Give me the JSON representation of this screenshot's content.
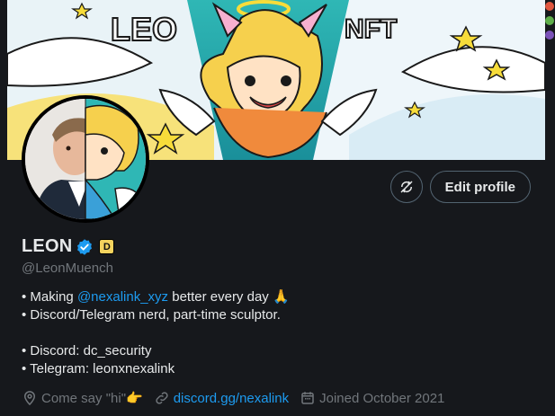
{
  "banner": {
    "title_left": "LEO",
    "title_right": "NFT"
  },
  "actions": {
    "edit_label": "Edit profile",
    "icon": "sync-off-icon"
  },
  "profile": {
    "name": "LEON",
    "affiliate_badge": "D",
    "handle": "@LeonMuench"
  },
  "bio": {
    "line1_prefix": "• Making ",
    "line1_mention": "@nexalink_xyz",
    "line1_suffix": " better every day 🙏",
    "line2": "• Discord/Telegram nerd, part-time sculptor.",
    "line3": "• Discord: dc_security",
    "line4": "• Telegram: leonxnexalink"
  },
  "meta": {
    "location": "Come say \"hi\"👉",
    "website": "discord.gg/nexalink",
    "joined": "Joined October 2021"
  },
  "colors": {
    "accent": "#1d9bf0",
    "muted": "#71767b",
    "background": "#16181c"
  }
}
